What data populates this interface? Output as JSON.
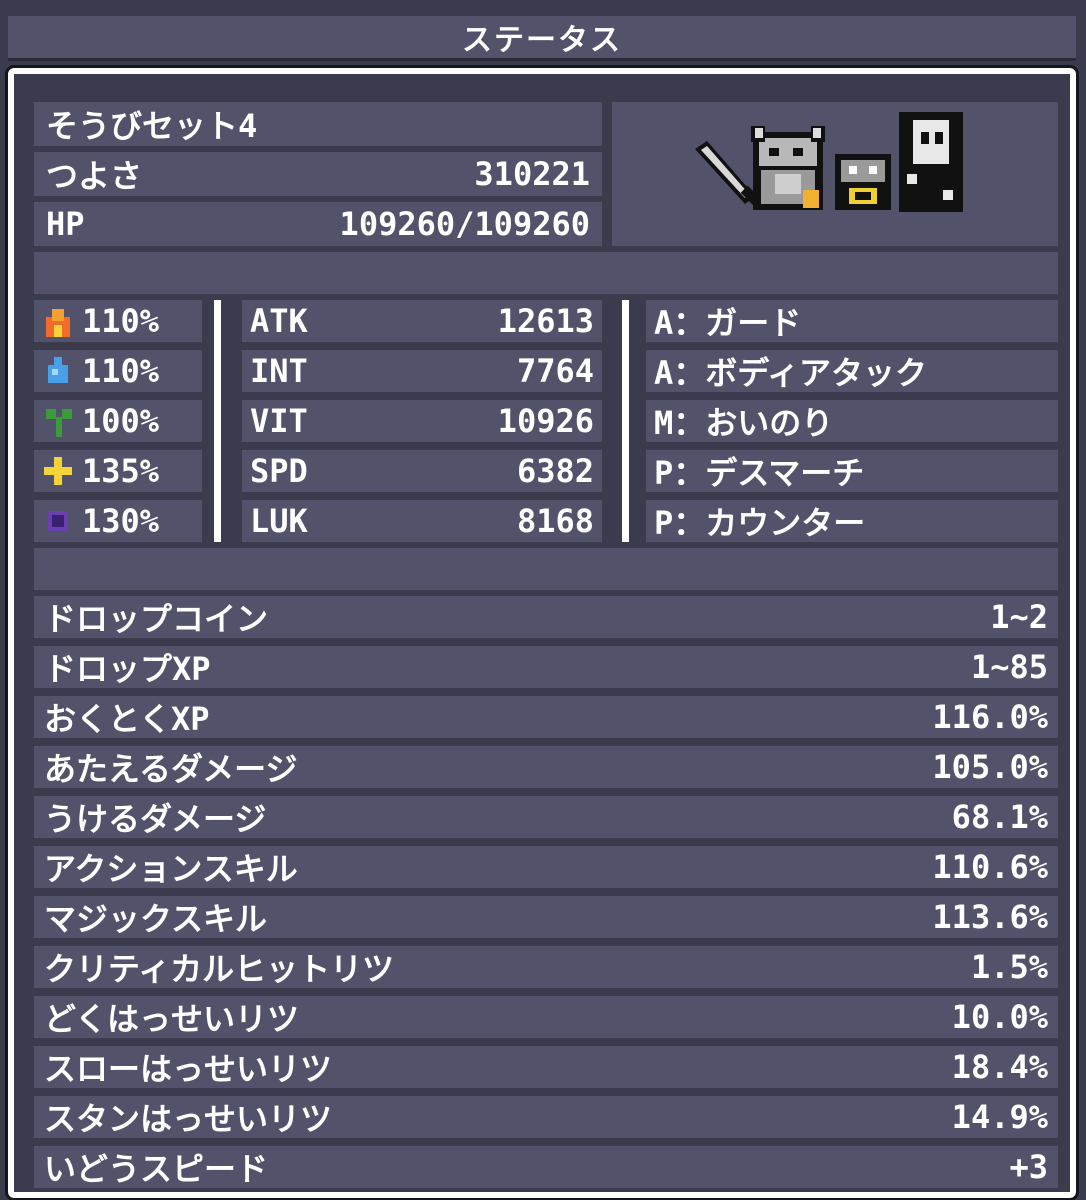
{
  "title": "ステータス",
  "header": {
    "set_name": "そうびセット4",
    "power_label": "つよさ",
    "power_value": "310221",
    "hp_label": "HP",
    "hp_value": "109260/109260"
  },
  "elements": [
    {
      "icon": "fire-icon",
      "value": "110%",
      "color": "#f26b2a"
    },
    {
      "icon": "water-icon",
      "value": "110%",
      "color": "#4aa0e8"
    },
    {
      "icon": "plant-icon",
      "value": "100%",
      "color": "#3c9a3c"
    },
    {
      "icon": "light-icon",
      "value": "135%",
      "color": "#f5d43a"
    },
    {
      "icon": "dark-icon",
      "value": "130%",
      "color": "#6a3fb0"
    }
  ],
  "stats": [
    {
      "label": "ATK",
      "value": "12613"
    },
    {
      "label": "INT",
      "value": "7764"
    },
    {
      "label": "VIT",
      "value": "10926"
    },
    {
      "label": "SPD",
      "value": "6382"
    },
    {
      "label": "LUK",
      "value": "8168"
    }
  ],
  "skills": [
    "A：ガード",
    "A：ボディアタック",
    "M：おいのり",
    "P：デスマーチ",
    "P：カウンター"
  ],
  "details": [
    {
      "label": "ドロップコイン",
      "value": "1~2"
    },
    {
      "label": "ドロップXP",
      "value": "1~85"
    },
    {
      "label": "おくとくXP",
      "value": "116.0%"
    },
    {
      "label": "あたえるダメージ",
      "value": "105.0%"
    },
    {
      "label": "うけるダメージ",
      "value": "68.1%"
    },
    {
      "label": "アクションスキル",
      "value": "110.6%"
    },
    {
      "label": "マジックスキル",
      "value": "113.6%"
    },
    {
      "label": "クリティカルヒットリツ",
      "value": "1.5%"
    },
    {
      "label": "どくはっせいリツ",
      "value": "10.0%"
    },
    {
      "label": "スローはっせいリツ",
      "value": "18.4%"
    },
    {
      "label": "スタンはっせいリツ",
      "value": "14.9%"
    },
    {
      "label": "いどうスピード",
      "value": "+3"
    }
  ],
  "colors": {
    "background": "#3b3b4e",
    "cell": "#52526a",
    "border": "#ffffff",
    "text": "#ffffff"
  }
}
